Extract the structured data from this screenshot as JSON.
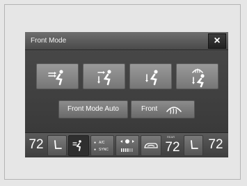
{
  "window": {
    "title": "Front Mode",
    "close_label": "×"
  },
  "mode_buttons": [
    {
      "name": "vent-mode",
      "icon": "vent-mode-icon"
    },
    {
      "name": "bilevel-mode",
      "icon": "bilevel-mode-icon"
    },
    {
      "name": "floor-mode",
      "icon": "floor-mode-icon"
    },
    {
      "name": "floor-defrost-mode",
      "icon": "floor-defrost-mode-icon"
    }
  ],
  "buttons": {
    "front_mode_auto": "Front Mode Auto",
    "front_defrost": "Front"
  },
  "bottom_bar": {
    "driver_temp": "72",
    "ac_label": "A/C",
    "sync_label": "SYNC",
    "rear_label": "REAR",
    "rear_temp": "72",
    "passenger_temp": "72"
  },
  "colors": {
    "screen_bg": "#1b1b1b",
    "button_gray": "#8a8a8a",
    "text": "#ffffff"
  }
}
